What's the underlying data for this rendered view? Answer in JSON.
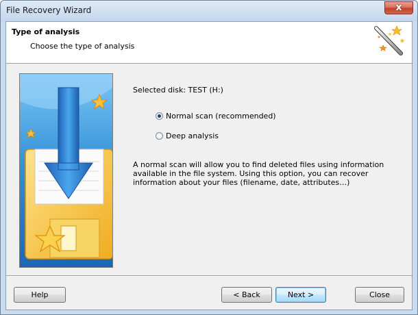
{
  "window": {
    "title": "File Recovery Wizard",
    "close_symbol": "x"
  },
  "header": {
    "title": "Type of analysis",
    "subtitle": "Choose the type of analysis",
    "icon": "magic-wand-icon"
  },
  "main": {
    "selected_disk": "Selected disk: TEST (H:)",
    "options": [
      {
        "label": "Normal scan (recommended)",
        "checked": true
      },
      {
        "label": "Deep analysis",
        "checked": false
      }
    ],
    "description": "A normal scan will allow you to find deleted files using information available in the file system. Using this option, you can recover information about your files (filename, date, attributes…)",
    "illustration": "floppy-disk-download-icon"
  },
  "buttons": {
    "help": "Help",
    "back": "< Back",
    "next": "Next >",
    "close": "Close"
  },
  "colors": {
    "title_bar": "#c9dcef",
    "close_button": "#c2422c",
    "illustration_bg": "#2f8fd6",
    "floppy": "#f6c94a",
    "default_button_border": "#3c7fb1"
  }
}
